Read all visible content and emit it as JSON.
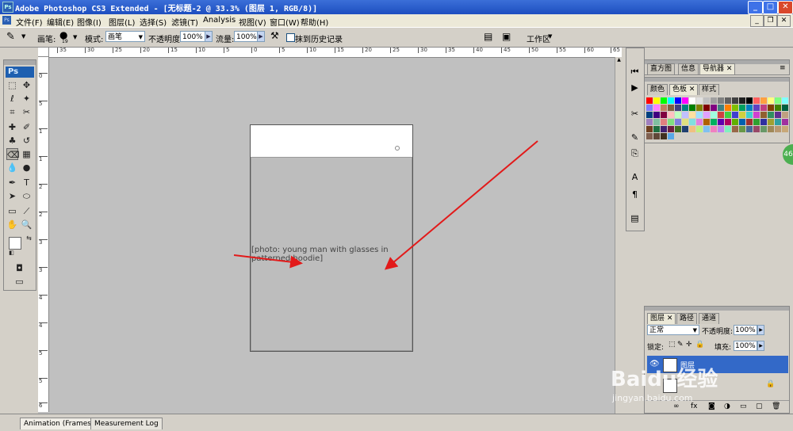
{
  "window": {
    "title": "Adobe Photoshop CS3 Extended - [无标题-2 @ 33.3% (图层 1, RGB/8)]",
    "app_logo": "Ps"
  },
  "menu": [
    "文件(F)",
    "编辑(E)",
    "图像(I)",
    "图层(L)",
    "选择(S)",
    "滤镜(T)",
    "Analysis",
    "视图(V)",
    "窗口(W)",
    "帮助(H)"
  ],
  "options": {
    "brush_label": "画笔:",
    "brush_size": "19",
    "mode_label": "模式:",
    "mode_value": "画笔",
    "opacity_label": "不透明度:",
    "opacity_value": "100%",
    "flow_label": "流量:",
    "flow_value": "100%",
    "history_label": "抹到历史记录",
    "workspace_label": "工作区"
  },
  "toolbox": {
    "badge": "Ps"
  },
  "rulers": {
    "h_labels": [
      "35",
      "30",
      "25",
      "20",
      "15",
      "10",
      "5",
      "0",
      "5",
      "10",
      "15",
      "20",
      "25",
      "30",
      "35",
      "40",
      "45",
      "50",
      "55",
      "60",
      "65"
    ],
    "v_labels": [
      "0",
      "5",
      "1",
      "1",
      "2",
      "2",
      "3",
      "3",
      "4",
      "4",
      "5",
      "5",
      "6"
    ]
  },
  "document": {
    "photo_label": "[photo: young man with glasses in patterned hoodie]"
  },
  "bottom_tabs": [
    "Animation (Frames)",
    "Measurement Log"
  ],
  "panels": {
    "nav_tabs": [
      "直方图",
      "信息",
      "导航器"
    ],
    "color_tabs": [
      "颜色",
      "色板",
      "样式"
    ],
    "layers_tabs": [
      "图层",
      "路径",
      "通道"
    ],
    "blend_mode": "正常",
    "opacity_label": "不透明度:",
    "opacity_value": "100%",
    "lock_label": "锁定:",
    "fill_label": "填充:",
    "fill_value": "100%",
    "layer1_name": "图层",
    "swatch_colors": [
      "#ff0000",
      "#ffff00",
      "#00ff00",
      "#00ffff",
      "#0000ff",
      "#ff00ff",
      "#ffffff",
      "#e0e0e0",
      "#c0c0c0",
      "#a0a0a0",
      "#808080",
      "#606060",
      "#404040",
      "#202020",
      "#000000",
      "#ff6060",
      "#ffa040",
      "#ffff80",
      "#80ff80",
      "#80ffff",
      "#8080ff",
      "#ff80ff",
      "#c08060",
      "#806040",
      "#404080",
      "#008080",
      "#008000",
      "#808000",
      "#800000",
      "#800080",
      "#408080",
      "#ff8000",
      "#80c000",
      "#00a060",
      "#0080c0",
      "#6040c0",
      "#c04080",
      "#804000",
      "#408000",
      "#006040",
      "#004080",
      "#400080",
      "#800040",
      "#ffc0c0",
      "#c0ffc0",
      "#c0c0ff",
      "#ffe0a0",
      "#a0e0ff",
      "#e0a0ff",
      "#a0ffe0",
      "#d04040",
      "#40d040",
      "#4040d0",
      "#d0d040",
      "#40d0d0",
      "#d040d0",
      "#906030",
      "#309060",
      "#603090",
      "#c0a080",
      "#a080c0",
      "#80c0a0",
      "#e08080",
      "#80e080",
      "#8080e0",
      "#e0e080",
      "#80e0e0",
      "#e080e0",
      "#b06000",
      "#00b060",
      "#6000b0",
      "#b00060",
      "#60b000",
      "#0060b0",
      "#a03030",
      "#30a030",
      "#3030a0",
      "#a0a030",
      "#30a0a0",
      "#a030a0",
      "#704020",
      "#207040",
      "#402070",
      "#702040",
      "#407020",
      "#204070",
      "#f0c080",
      "#c0f080",
      "#80c0f0",
      "#f080c0",
      "#c080f0",
      "#80f0c0",
      "#986848",
      "#689848",
      "#486898",
      "#984868",
      "#689868",
      "#a08858",
      "#b89870",
      "#c8a878",
      "#806050",
      "#604838",
      "#403020",
      "#59a8e8"
    ]
  },
  "watermark": {
    "text": "Baidu经验",
    "url": "jingyan.baidu.com"
  },
  "side_badge": "46"
}
